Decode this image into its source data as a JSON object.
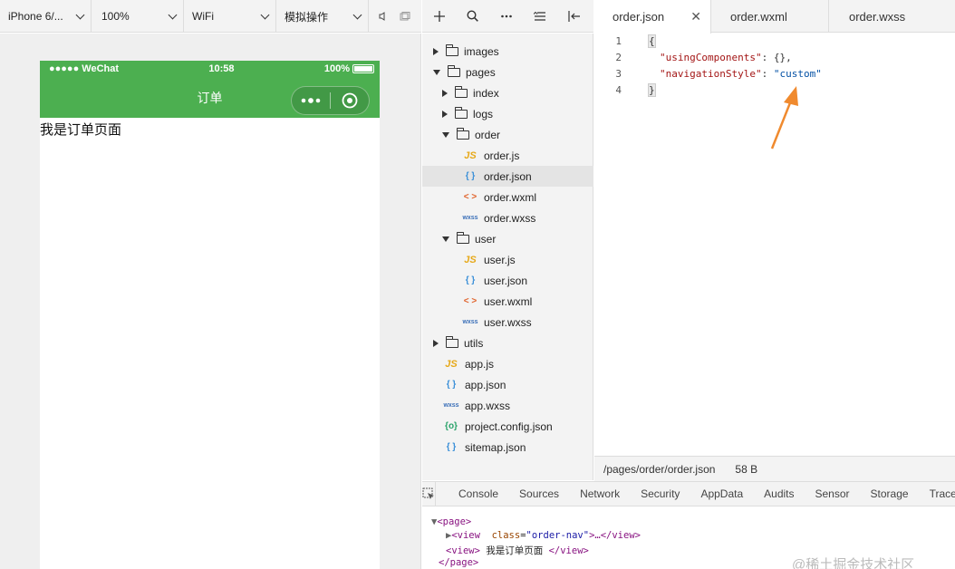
{
  "toolbar": {
    "device": "iPhone 6/...",
    "zoom": "100%",
    "network": "WiFi",
    "simulate": "模拟操作"
  },
  "simulator": {
    "status": {
      "carrier": "●●●●● WeChat",
      "time": "10:58",
      "battery": "100%"
    },
    "nav_title": "订单",
    "page_text": "我是订单页面"
  },
  "tree": {
    "items": [
      {
        "label": "images",
        "kind": "folder",
        "state": "collapsed",
        "level": 0
      },
      {
        "label": "pages",
        "kind": "folder",
        "state": "expanded",
        "level": 0
      },
      {
        "label": "index",
        "kind": "folder",
        "state": "collapsed",
        "level": 1
      },
      {
        "label": "logs",
        "kind": "folder",
        "state": "collapsed",
        "level": 1
      },
      {
        "label": "order",
        "kind": "folder",
        "state": "expanded",
        "level": 1
      },
      {
        "label": "order.js",
        "kind": "js",
        "level": 2
      },
      {
        "label": "order.json",
        "kind": "json",
        "level": 2,
        "selected": true
      },
      {
        "label": "order.wxml",
        "kind": "wxml",
        "level": 2
      },
      {
        "label": "order.wxss",
        "kind": "wxss",
        "level": 2
      },
      {
        "label": "user",
        "kind": "folder",
        "state": "expanded",
        "level": 1
      },
      {
        "label": "user.js",
        "kind": "js",
        "level": 2
      },
      {
        "label": "user.json",
        "kind": "json",
        "level": 2
      },
      {
        "label": "user.wxml",
        "kind": "wxml",
        "level": 2
      },
      {
        "label": "user.wxss",
        "kind": "wxss",
        "level": 2
      },
      {
        "label": "utils",
        "kind": "folder",
        "state": "collapsed",
        "level": 0
      },
      {
        "label": "app.js",
        "kind": "js",
        "level": 0
      },
      {
        "label": "app.json",
        "kind": "json",
        "level": 0
      },
      {
        "label": "app.wxss",
        "kind": "wxss",
        "level": 0
      },
      {
        "label": "project.config.json",
        "kind": "cfg",
        "level": 0
      },
      {
        "label": "sitemap.json",
        "kind": "json",
        "level": 0
      }
    ],
    "icons": {
      "js": "JS",
      "json": "{ }",
      "wxml": "< >",
      "wxss": "wxss",
      "cfg": "{o}"
    }
  },
  "editor": {
    "tabs": [
      {
        "label": "order.json",
        "active": true,
        "close": "✕"
      },
      {
        "label": "order.wxml"
      },
      {
        "label": "order.wxss"
      }
    ],
    "line_numbers": [
      "1",
      "2",
      "3",
      "4"
    ],
    "code": {
      "l1": "{",
      "l2_key": "\"usingComponents\"",
      "l2_rest": ": {},",
      "l3_key": "\"navigationStyle\"",
      "l3_colon": ": ",
      "l3_val": "\"custom\"",
      "l4": "}"
    },
    "status": {
      "path": "/pages/order/order.json",
      "size": "58 B"
    },
    "arrow_color": "#f08a2e"
  },
  "devtools": {
    "tabs": [
      "Console",
      "Sources",
      "Network",
      "Security",
      "AppData",
      "Audits",
      "Sensor",
      "Storage",
      "Trace"
    ],
    "dom": {
      "page_open": "<page>",
      "view_open": "<view",
      "class_attr": "class",
      "class_val": "\"order-nav\"",
      "ellipsis": ">…</view>",
      "view2_open": "<view>",
      "view2_text": " 我是订单页面 ",
      "view2_close": "</view>",
      "page_close": "</page>"
    }
  },
  "watermark": "@稀土掘金技术社区",
  "colors": {
    "nav_green": "#4caf50",
    "accent_orange": "#f08a2e"
  }
}
